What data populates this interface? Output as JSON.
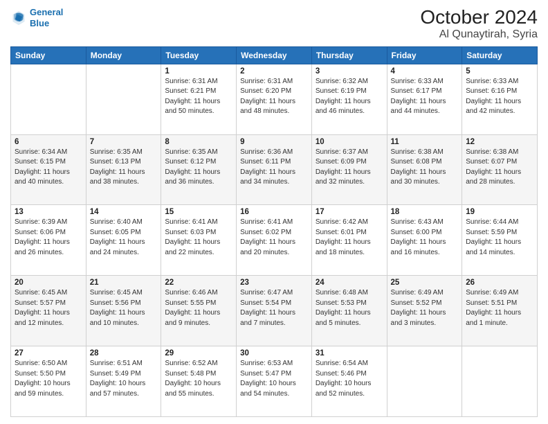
{
  "header": {
    "logo_line1": "General",
    "logo_line2": "Blue",
    "month": "October 2024",
    "location": "Al Qunaytirah, Syria"
  },
  "weekdays": [
    "Sunday",
    "Monday",
    "Tuesday",
    "Wednesday",
    "Thursday",
    "Friday",
    "Saturday"
  ],
  "weeks": [
    [
      {
        "day": null
      },
      {
        "day": null
      },
      {
        "day": "1",
        "sunrise": "6:31 AM",
        "sunset": "6:21 PM",
        "daylight": "11 hours and 50 minutes."
      },
      {
        "day": "2",
        "sunrise": "6:31 AM",
        "sunset": "6:20 PM",
        "daylight": "11 hours and 48 minutes."
      },
      {
        "day": "3",
        "sunrise": "6:32 AM",
        "sunset": "6:19 PM",
        "daylight": "11 hours and 46 minutes."
      },
      {
        "day": "4",
        "sunrise": "6:33 AM",
        "sunset": "6:17 PM",
        "daylight": "11 hours and 44 minutes."
      },
      {
        "day": "5",
        "sunrise": "6:33 AM",
        "sunset": "6:16 PM",
        "daylight": "11 hours and 42 minutes."
      }
    ],
    [
      {
        "day": "6",
        "sunrise": "6:34 AM",
        "sunset": "6:15 PM",
        "daylight": "11 hours and 40 minutes."
      },
      {
        "day": "7",
        "sunrise": "6:35 AM",
        "sunset": "6:13 PM",
        "daylight": "11 hours and 38 minutes."
      },
      {
        "day": "8",
        "sunrise": "6:35 AM",
        "sunset": "6:12 PM",
        "daylight": "11 hours and 36 minutes."
      },
      {
        "day": "9",
        "sunrise": "6:36 AM",
        "sunset": "6:11 PM",
        "daylight": "11 hours and 34 minutes."
      },
      {
        "day": "10",
        "sunrise": "6:37 AM",
        "sunset": "6:09 PM",
        "daylight": "11 hours and 32 minutes."
      },
      {
        "day": "11",
        "sunrise": "6:38 AM",
        "sunset": "6:08 PM",
        "daylight": "11 hours and 30 minutes."
      },
      {
        "day": "12",
        "sunrise": "6:38 AM",
        "sunset": "6:07 PM",
        "daylight": "11 hours and 28 minutes."
      }
    ],
    [
      {
        "day": "13",
        "sunrise": "6:39 AM",
        "sunset": "6:06 PM",
        "daylight": "11 hours and 26 minutes."
      },
      {
        "day": "14",
        "sunrise": "6:40 AM",
        "sunset": "6:05 PM",
        "daylight": "11 hours and 24 minutes."
      },
      {
        "day": "15",
        "sunrise": "6:41 AM",
        "sunset": "6:03 PM",
        "daylight": "11 hours and 22 minutes."
      },
      {
        "day": "16",
        "sunrise": "6:41 AM",
        "sunset": "6:02 PM",
        "daylight": "11 hours and 20 minutes."
      },
      {
        "day": "17",
        "sunrise": "6:42 AM",
        "sunset": "6:01 PM",
        "daylight": "11 hours and 18 minutes."
      },
      {
        "day": "18",
        "sunrise": "6:43 AM",
        "sunset": "6:00 PM",
        "daylight": "11 hours and 16 minutes."
      },
      {
        "day": "19",
        "sunrise": "6:44 AM",
        "sunset": "5:59 PM",
        "daylight": "11 hours and 14 minutes."
      }
    ],
    [
      {
        "day": "20",
        "sunrise": "6:45 AM",
        "sunset": "5:57 PM",
        "daylight": "11 hours and 12 minutes."
      },
      {
        "day": "21",
        "sunrise": "6:45 AM",
        "sunset": "5:56 PM",
        "daylight": "11 hours and 10 minutes."
      },
      {
        "day": "22",
        "sunrise": "6:46 AM",
        "sunset": "5:55 PM",
        "daylight": "11 hours and 9 minutes."
      },
      {
        "day": "23",
        "sunrise": "6:47 AM",
        "sunset": "5:54 PM",
        "daylight": "11 hours and 7 minutes."
      },
      {
        "day": "24",
        "sunrise": "6:48 AM",
        "sunset": "5:53 PM",
        "daylight": "11 hours and 5 minutes."
      },
      {
        "day": "25",
        "sunrise": "6:49 AM",
        "sunset": "5:52 PM",
        "daylight": "11 hours and 3 minutes."
      },
      {
        "day": "26",
        "sunrise": "6:49 AM",
        "sunset": "5:51 PM",
        "daylight": "11 hours and 1 minute."
      }
    ],
    [
      {
        "day": "27",
        "sunrise": "6:50 AM",
        "sunset": "5:50 PM",
        "daylight": "10 hours and 59 minutes."
      },
      {
        "day": "28",
        "sunrise": "6:51 AM",
        "sunset": "5:49 PM",
        "daylight": "10 hours and 57 minutes."
      },
      {
        "day": "29",
        "sunrise": "6:52 AM",
        "sunset": "5:48 PM",
        "daylight": "10 hours and 55 minutes."
      },
      {
        "day": "30",
        "sunrise": "6:53 AM",
        "sunset": "5:47 PM",
        "daylight": "10 hours and 54 minutes."
      },
      {
        "day": "31",
        "sunrise": "6:54 AM",
        "sunset": "5:46 PM",
        "daylight": "10 hours and 52 minutes."
      },
      {
        "day": null
      },
      {
        "day": null
      }
    ]
  ]
}
